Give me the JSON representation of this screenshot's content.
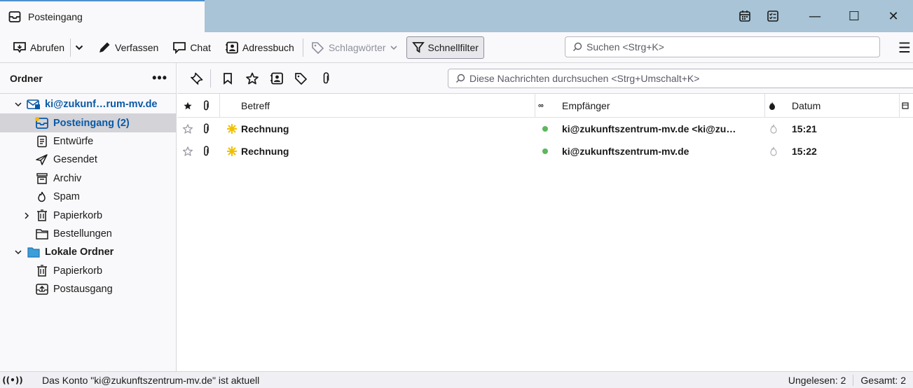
{
  "window": {
    "tab_title": "Posteingang",
    "controls": {
      "minimize": "—",
      "maximize": "☐",
      "close": "✕"
    }
  },
  "toolbar": {
    "get_messages": "Abrufen",
    "compose": "Verfassen",
    "chat": "Chat",
    "address_book": "Adressbuch",
    "tags": "Schlagwörter",
    "quick_filter": "Schnellfilter",
    "search_placeholder": "Suchen <Strg+K>"
  },
  "folder_pane": {
    "title": "Ordner",
    "more": "•••",
    "folders": [
      {
        "label": "ki@zukunf…rum-mv.de",
        "icon": "mail-account-icon",
        "level": 0,
        "twisty": "expanded"
      },
      {
        "label": "Posteingang (2)",
        "icon": "inbox-icon",
        "level": 1,
        "selected": true
      },
      {
        "label": "Entwürfe",
        "icon": "drafts-icon",
        "level": 1
      },
      {
        "label": "Gesendet",
        "icon": "sent-icon",
        "level": 1
      },
      {
        "label": "Archiv",
        "icon": "archive-icon",
        "level": 1
      },
      {
        "label": "Spam",
        "icon": "spam-icon",
        "level": 1
      },
      {
        "label": "Papierkorb",
        "icon": "trash-icon",
        "level": 1,
        "twisty": "collapsed"
      },
      {
        "label": "Bestellungen",
        "icon": "folder-icon",
        "level": 1
      },
      {
        "label": "Lokale Ordner",
        "icon": "local-folders-icon",
        "level": 0,
        "twisty": "expanded"
      },
      {
        "label": "Papierkorb",
        "icon": "trash-icon",
        "level": 1
      },
      {
        "label": "Postausgang",
        "icon": "outbox-icon",
        "level": 1
      }
    ]
  },
  "message_pane": {
    "search_placeholder": "Diese Nachrichten durchsuchen <Strg+Umschalt+K>",
    "columns": {
      "subject": "Betreff",
      "recipient": "Empfänger",
      "date": "Datum"
    },
    "messages": [
      {
        "subject": "Rechnung",
        "recipient": "ki@zukunftszentrum-mv.de <ki@zu…",
        "date": "15:21"
      },
      {
        "subject": "Rechnung",
        "recipient": "ki@zukunftszentrum-mv.de",
        "date": "15:22"
      }
    ]
  },
  "status_bar": {
    "message": "Das Konto \"ki@zukunftszentrum-mv.de\" ist aktuell",
    "unread": "Ungelesen: 2",
    "total": "Gesamt: 2"
  },
  "colors": {
    "titlebar": "#a8c4d6",
    "selection": "#d3d3d8",
    "link": "#0a59a6",
    "status_dot": "#5cb85c"
  }
}
